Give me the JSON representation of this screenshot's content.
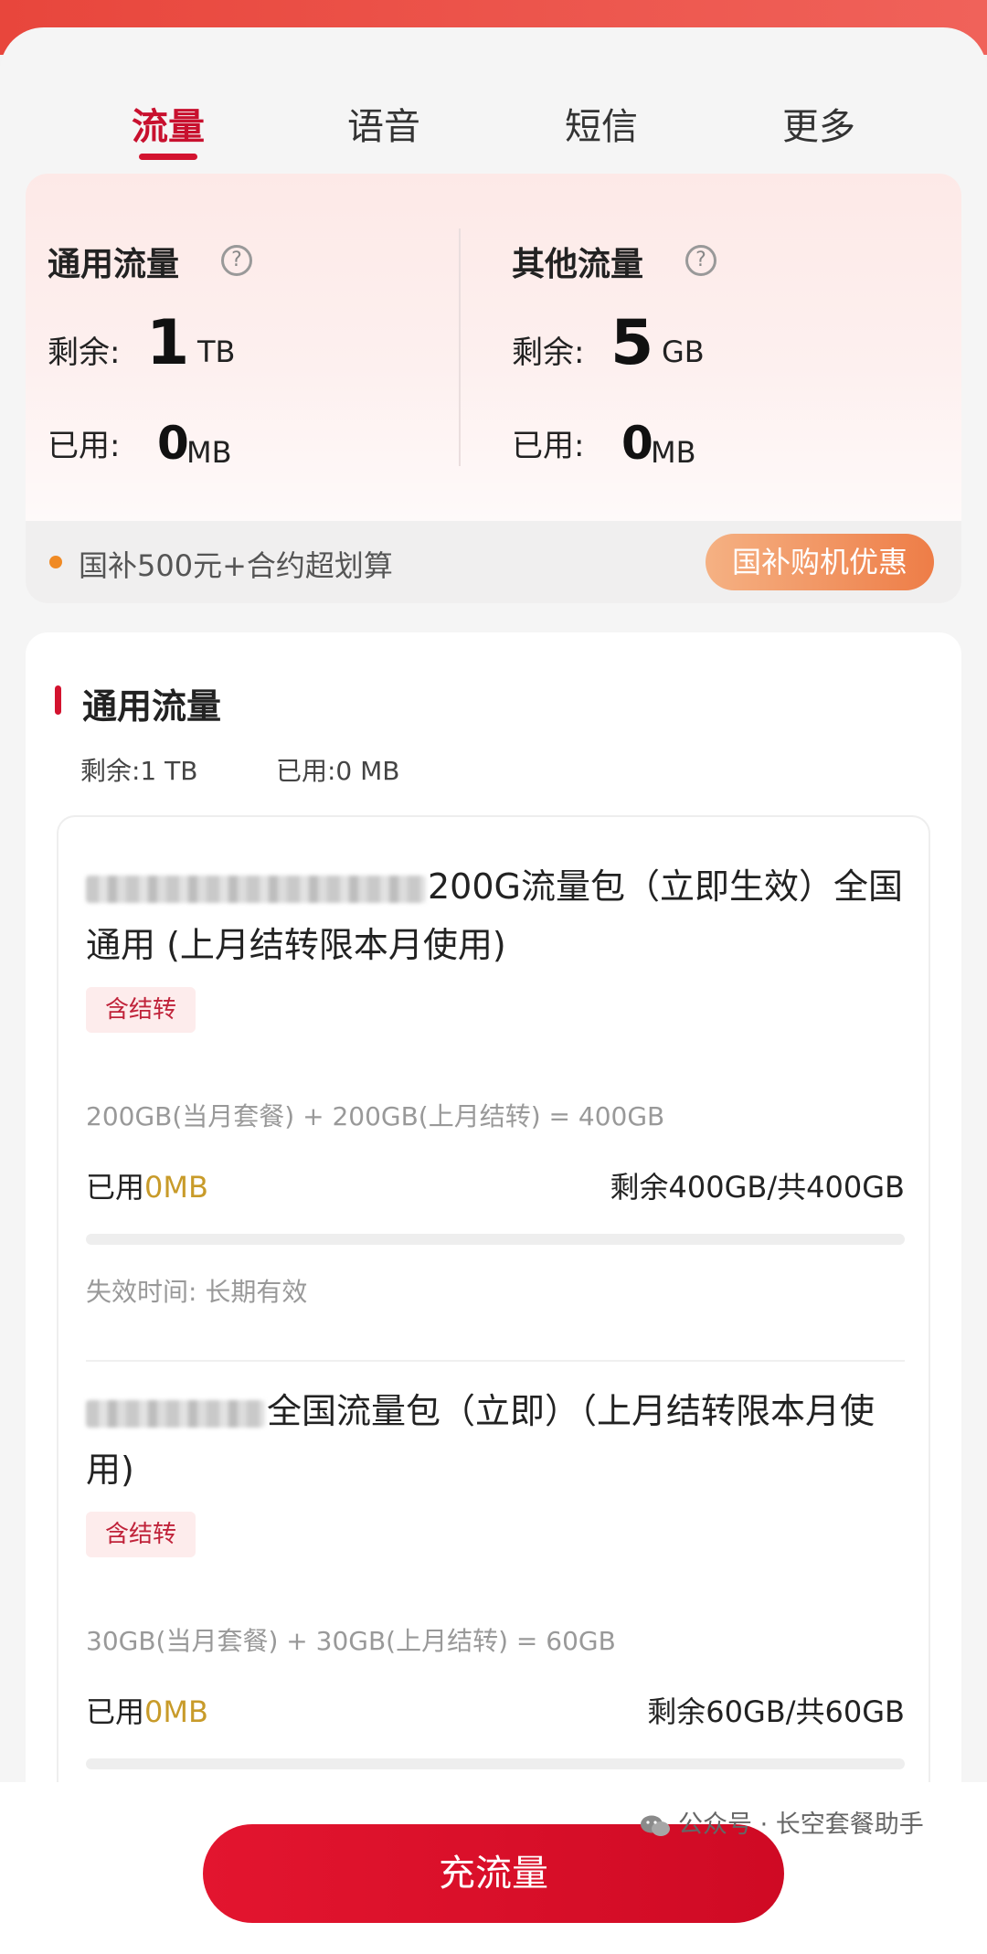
{
  "tabs": [
    {
      "label": "流量",
      "active": true
    },
    {
      "label": "语音",
      "active": false
    },
    {
      "label": "短信",
      "active": false
    },
    {
      "label": "更多",
      "active": false
    }
  ],
  "summary": {
    "general": {
      "title": "通用流量",
      "remain_label": "剩余:",
      "remain_value": "1",
      "remain_unit": "TB",
      "used_label": "已用:",
      "used_value": "0",
      "used_unit": "MB"
    },
    "other": {
      "title": "其他流量",
      "remain_label": "剩余:",
      "remain_value": "5",
      "remain_unit": "GB",
      "used_label": "已用:",
      "used_value": "0",
      "used_unit": "MB"
    },
    "help_glyph": "?"
  },
  "promo": {
    "text": "国补500元+合约超划算",
    "button": "国补购机优惠"
  },
  "detail": {
    "title": "通用流量",
    "remain_stat": "剩余:1 TB",
    "used_stat": "已用:0 MB",
    "packages": [
      {
        "name": "200G流量包（立即生效）全国通用 (上月结转限本月使用)",
        "tag": "含结转",
        "formula": "200GB(当月套餐) + 200GB(上月结转) = 400GB",
        "used_label": "已用",
        "used_value": "0MB",
        "remain": "剩余400GB/共400GB",
        "used_fraction": 0,
        "expire": "失效时间: 长期有效"
      },
      {
        "name": "全国流量包（立即）（上月结转限本月使用)",
        "tag": "含结转",
        "formula": "30GB(当月套餐) + 30GB(上月结转) = 60GB",
        "used_label": "已用",
        "used_value": "0MB",
        "remain": "剩余60GB/共60GB",
        "used_fraction": 0
      }
    ]
  },
  "cta": {
    "label": "充流量"
  },
  "watermark": {
    "text": "公众号 · 长空套餐助手"
  },
  "colors": {
    "brand_red": "#d3132f",
    "highlight": "#c89b2a",
    "promo_orange": "#ee7d47"
  }
}
